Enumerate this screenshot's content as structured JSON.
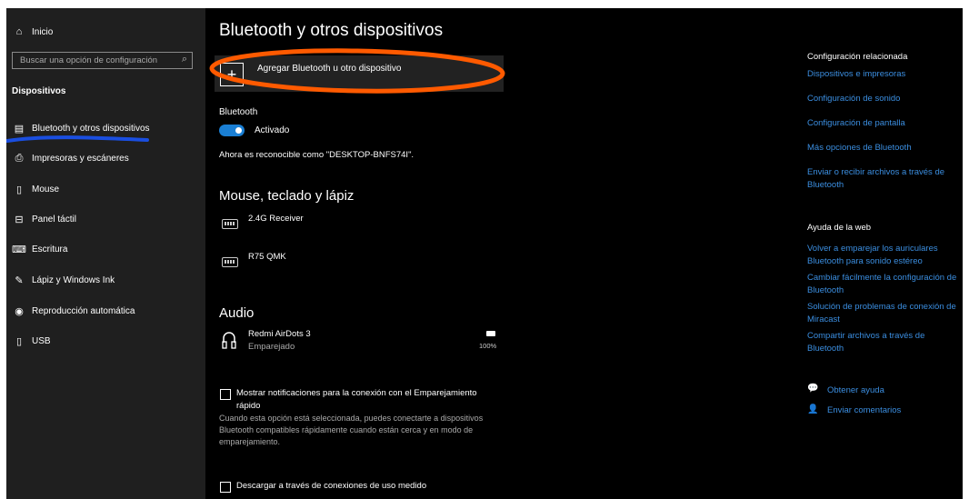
{
  "sidebar": {
    "home_label": "Inicio",
    "search_placeholder": "Buscar una opción de configuración",
    "section_title": "Dispositivos",
    "items": [
      {
        "label": "Bluetooth y otros dispositivos",
        "icon": "bluetooth-devices-icon"
      },
      {
        "label": "Impresoras y escáneres",
        "icon": "printer-icon"
      },
      {
        "label": "Mouse",
        "icon": "mouse-icon"
      },
      {
        "label": "Panel táctil",
        "icon": "touchpad-icon"
      },
      {
        "label": "Escritura",
        "icon": "keyboard-icon"
      },
      {
        "label": "Lápiz y Windows Ink",
        "icon": "pen-icon"
      },
      {
        "label": "Reproducción automática",
        "icon": "autoplay-icon"
      },
      {
        "label": "USB",
        "icon": "usb-icon"
      }
    ]
  },
  "main": {
    "title": "Bluetooth y otros dispositivos",
    "add_button_label": "Agregar Bluetooth u otro dispositivo",
    "bluetooth_label": "Bluetooth",
    "bluetooth_state": "Activado",
    "discoverable_text": "Ahora es reconocible como \"DESKTOP-BNFS74I\".",
    "mouse_section_title": "Mouse, teclado y lápiz",
    "mouse_devices": [
      {
        "name": "2.4G Receiver"
      },
      {
        "name": "R75 QMK"
      }
    ],
    "audio_section_title": "Audio",
    "audio_device": {
      "name": "Redmi AirDots 3",
      "status": "Emparejado",
      "battery": "100%"
    },
    "swift_pair_label_1": "Mostrar notificaciones para la conexión con el Emparejamiento",
    "swift_pair_label_2": "rápido",
    "swift_pair_desc": [
      "Cuando esta opción está seleccionada, puedes conectarte a dispositivos",
      "Bluetooth compatibles rápidamente cuando están cerca y en modo de",
      "emparejamiento."
    ],
    "metered_label": "Descargar a través de conexiones de uso medido"
  },
  "related": {
    "title": "Configuración relacionada",
    "links": [
      "Dispositivos e impresoras",
      "Configuración de sonido",
      "Configuración de pantalla",
      "Más opciones de Bluetooth",
      "Enviar o recibir archivos a través de Bluetooth"
    ]
  },
  "help": {
    "title": "Ayuda de la web",
    "links": [
      "Volver a emparejar los auriculares Bluetooth para sonido estéreo",
      "Cambiar fácilmente la configuración de Bluetooth",
      "Solución de problemas de conexión de Miracast",
      "Compartir archivos a través de Bluetooth"
    ],
    "get_help": "Obtener ayuda",
    "feedback": "Enviar comentarios"
  },
  "colors": {
    "accent": "#1a7fd4",
    "link": "#3b8ee0",
    "annotation_orange": "#ff5a00",
    "annotation_blue": "#1a4ee0"
  }
}
